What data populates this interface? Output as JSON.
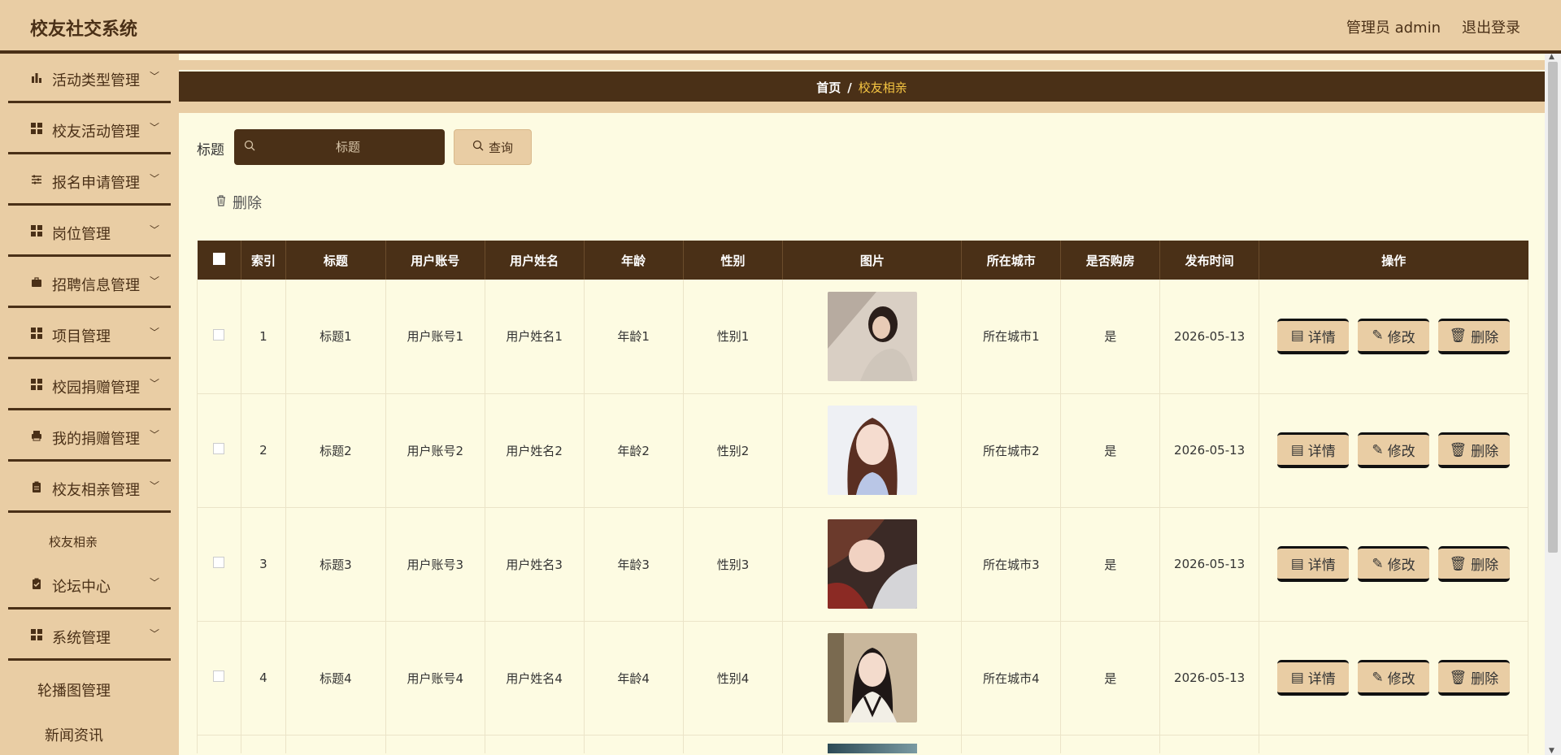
{
  "header": {
    "brand": "校友社交系统",
    "user": "管理员 admin",
    "logout": "退出登录"
  },
  "sidebar": {
    "menus": [
      {
        "label": "活动类型管理",
        "icon": "bar-chart-icon"
      },
      {
        "label": "校友活动管理",
        "icon": "grid-icon"
      },
      {
        "label": "报名申请管理",
        "icon": "sliders-icon"
      },
      {
        "label": "岗位管理",
        "icon": "grid-icon"
      },
      {
        "label": "招聘信息管理",
        "icon": "briefcase-icon"
      },
      {
        "label": "项目管理",
        "icon": "grid-icon"
      },
      {
        "label": "校园捐赠管理",
        "icon": "grid-icon"
      },
      {
        "label": "我的捐赠管理",
        "icon": "printer-icon"
      },
      {
        "label": "校友相亲管理",
        "icon": "clipboard-icon"
      },
      {
        "label": "论坛中心",
        "icon": "clipboard-check-icon"
      },
      {
        "label": "系统管理",
        "icon": "grid-icon"
      }
    ],
    "sub_item": "校友相亲",
    "extra": [
      "轮播图管理",
      "新闻资讯"
    ]
  },
  "breadcrumb": {
    "home": "首页",
    "sep": "/",
    "current": "校友相亲"
  },
  "search": {
    "label": "标题",
    "placeholder": "标题",
    "button": "查询"
  },
  "toolbar": {
    "delete": "删除"
  },
  "table": {
    "headers": [
      "索引",
      "标题",
      "用户账号",
      "用户姓名",
      "年龄",
      "性别",
      "图片",
      "所在城市",
      "是否购房",
      "发布时间",
      "操作"
    ],
    "rows": [
      {
        "index": "1",
        "title": "标题1",
        "account": "用户账号1",
        "name": "用户姓名1",
        "age": "年龄1",
        "gender": "性别1",
        "city": "所在城市1",
        "house": "是",
        "date": "2026-05-13"
      },
      {
        "index": "2",
        "title": "标题2",
        "account": "用户账号2",
        "name": "用户姓名2",
        "age": "年龄2",
        "gender": "性别2",
        "city": "所在城市2",
        "house": "是",
        "date": "2026-05-13"
      },
      {
        "index": "3",
        "title": "标题3",
        "account": "用户账号3",
        "name": "用户姓名3",
        "age": "年龄3",
        "gender": "性别3",
        "city": "所在城市3",
        "house": "是",
        "date": "2026-05-13"
      },
      {
        "index": "4",
        "title": "标题4",
        "account": "用户账号4",
        "name": "用户姓名4",
        "age": "年龄4",
        "gender": "性别4",
        "city": "所在城市4",
        "house": "是",
        "date": "2026-05-13"
      }
    ],
    "actions": {
      "detail": "详情",
      "edit": "修改",
      "delete": "删除"
    }
  },
  "colors": {
    "brown": "#4a3017",
    "tan": "#e9cda4",
    "cream": "#fdfbe2",
    "highlight": "#f5c542"
  }
}
